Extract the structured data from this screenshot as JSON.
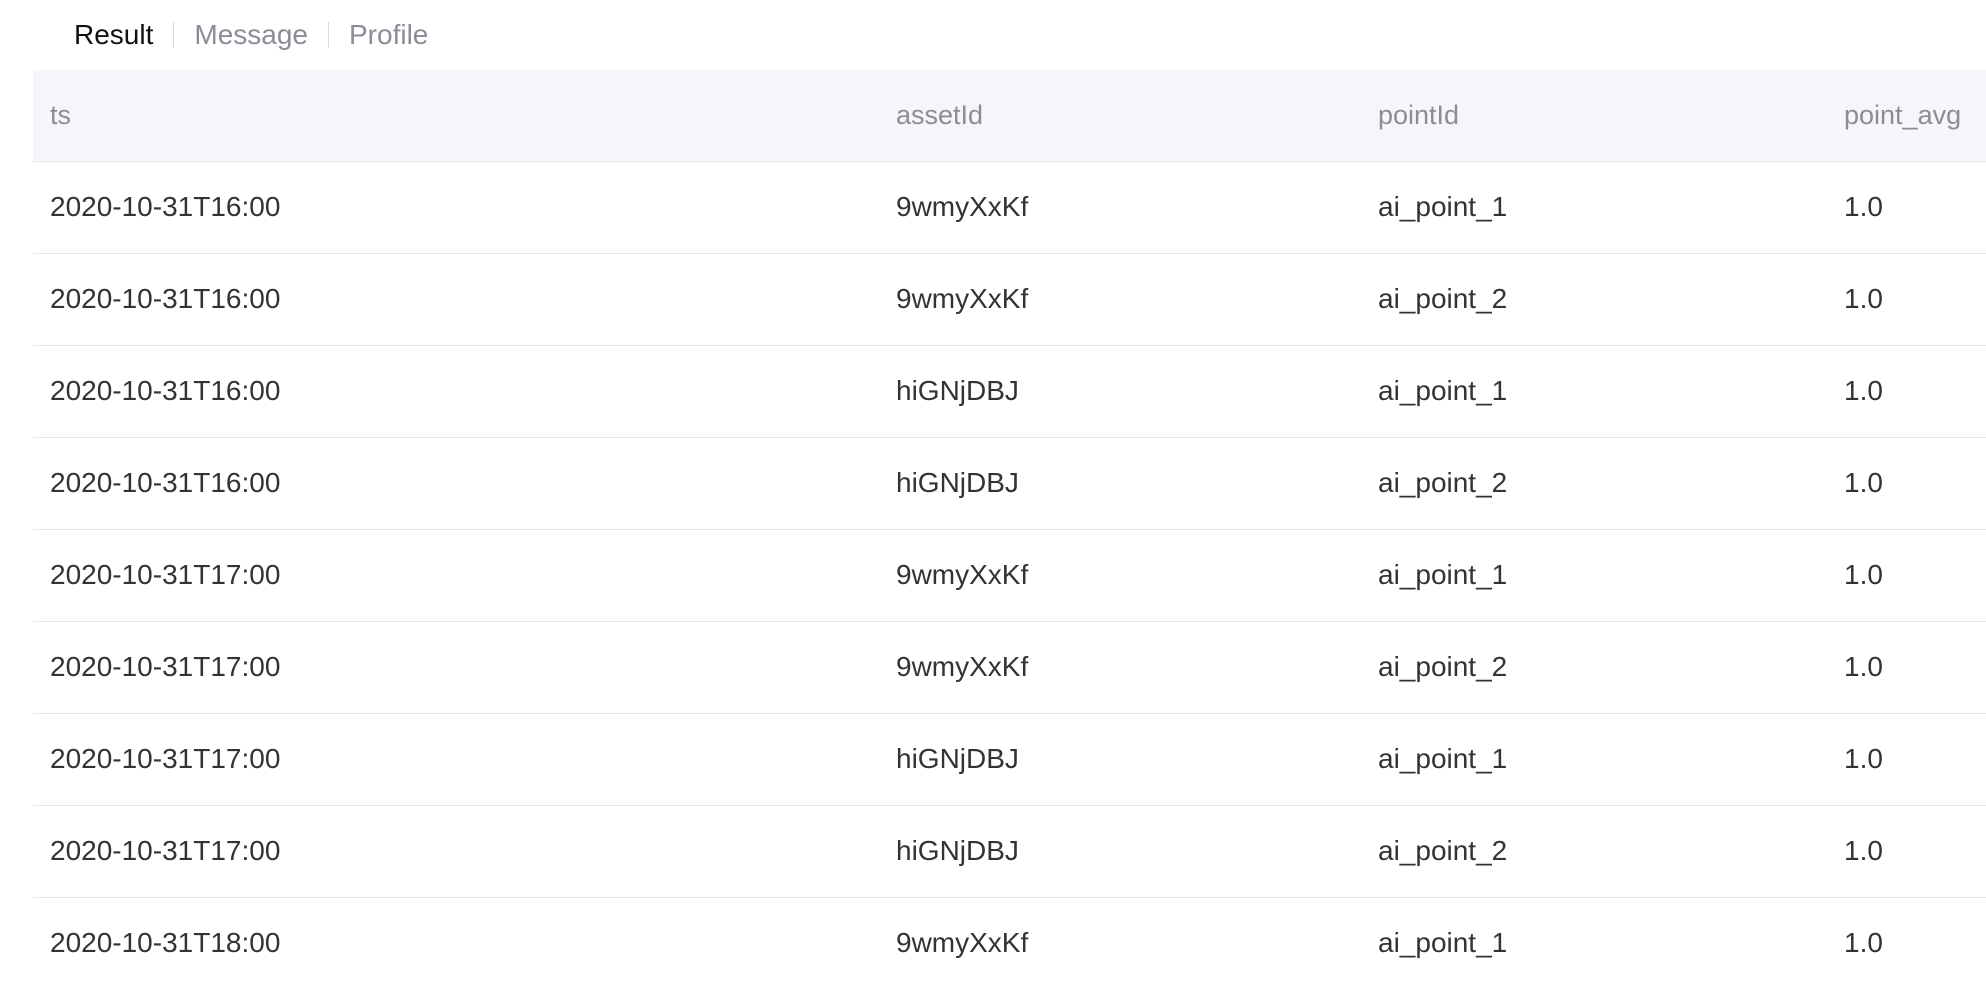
{
  "tabs": [
    {
      "label": "Result",
      "active": true
    },
    {
      "label": "Message",
      "active": false
    },
    {
      "label": "Profile",
      "active": false
    }
  ],
  "table": {
    "columns": [
      "ts",
      "assetId",
      "pointId",
      "point_avg"
    ],
    "rows": [
      [
        "2020-10-31T16:00",
        "9wmyXxKf",
        "ai_point_1",
        "1.0"
      ],
      [
        "2020-10-31T16:00",
        "9wmyXxKf",
        "ai_point_2",
        "1.0"
      ],
      [
        "2020-10-31T16:00",
        "hiGNjDBJ",
        "ai_point_1",
        "1.0"
      ],
      [
        "2020-10-31T16:00",
        "hiGNjDBJ",
        "ai_point_2",
        "1.0"
      ],
      [
        "2020-10-31T17:00",
        "9wmyXxKf",
        "ai_point_1",
        "1.0"
      ],
      [
        "2020-10-31T17:00",
        "9wmyXxKf",
        "ai_point_2",
        "1.0"
      ],
      [
        "2020-10-31T17:00",
        "hiGNjDBJ",
        "ai_point_1",
        "1.0"
      ],
      [
        "2020-10-31T17:00",
        "hiGNjDBJ",
        "ai_point_2",
        "1.0"
      ],
      [
        "2020-10-31T18:00",
        "9wmyXxKf",
        "ai_point_1",
        "1.0"
      ]
    ]
  }
}
